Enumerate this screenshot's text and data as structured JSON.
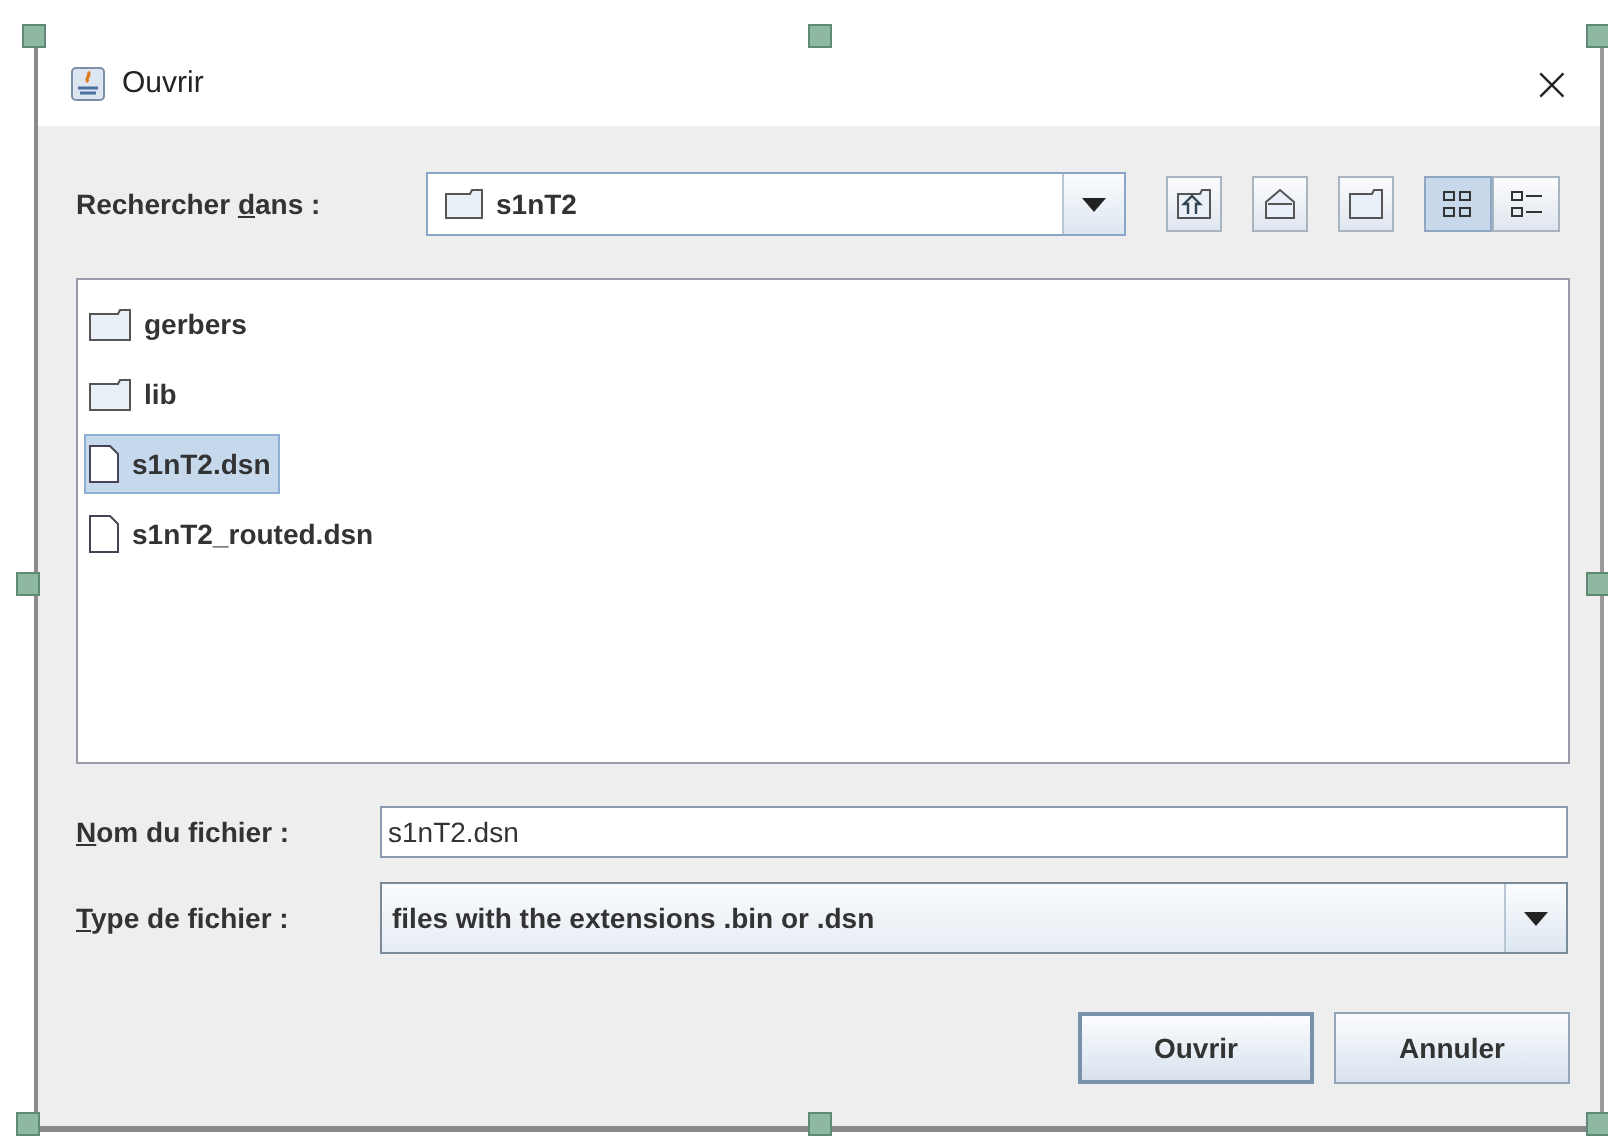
{
  "window": {
    "title": "Ouvrir",
    "close": "×"
  },
  "look_in": {
    "label": "Rechercher dans :",
    "value": "s1nT2"
  },
  "view_buttons": [
    {
      "kind": "list",
      "selected": true
    },
    {
      "kind": "details",
      "selected": false
    }
  ],
  "files": [
    {
      "kind": "folder",
      "name": "gerbers",
      "selected": false
    },
    {
      "kind": "folder",
      "name": "lib",
      "selected": false
    },
    {
      "kind": "file",
      "name": "s1nT2.dsn",
      "selected": true
    },
    {
      "kind": "file",
      "name": "s1nT2_routed.dsn",
      "selected": false
    }
  ],
  "file_name": {
    "label": "Nom du fichier :",
    "value": "s1nT2.dsn"
  },
  "file_type": {
    "label": "Type de fichier :",
    "value": "files with the extensions .bin or  .dsn"
  },
  "buttons": [
    {
      "label": "Ouvrir",
      "default": true
    },
    {
      "label": "Annuler",
      "default": false
    }
  ]
}
